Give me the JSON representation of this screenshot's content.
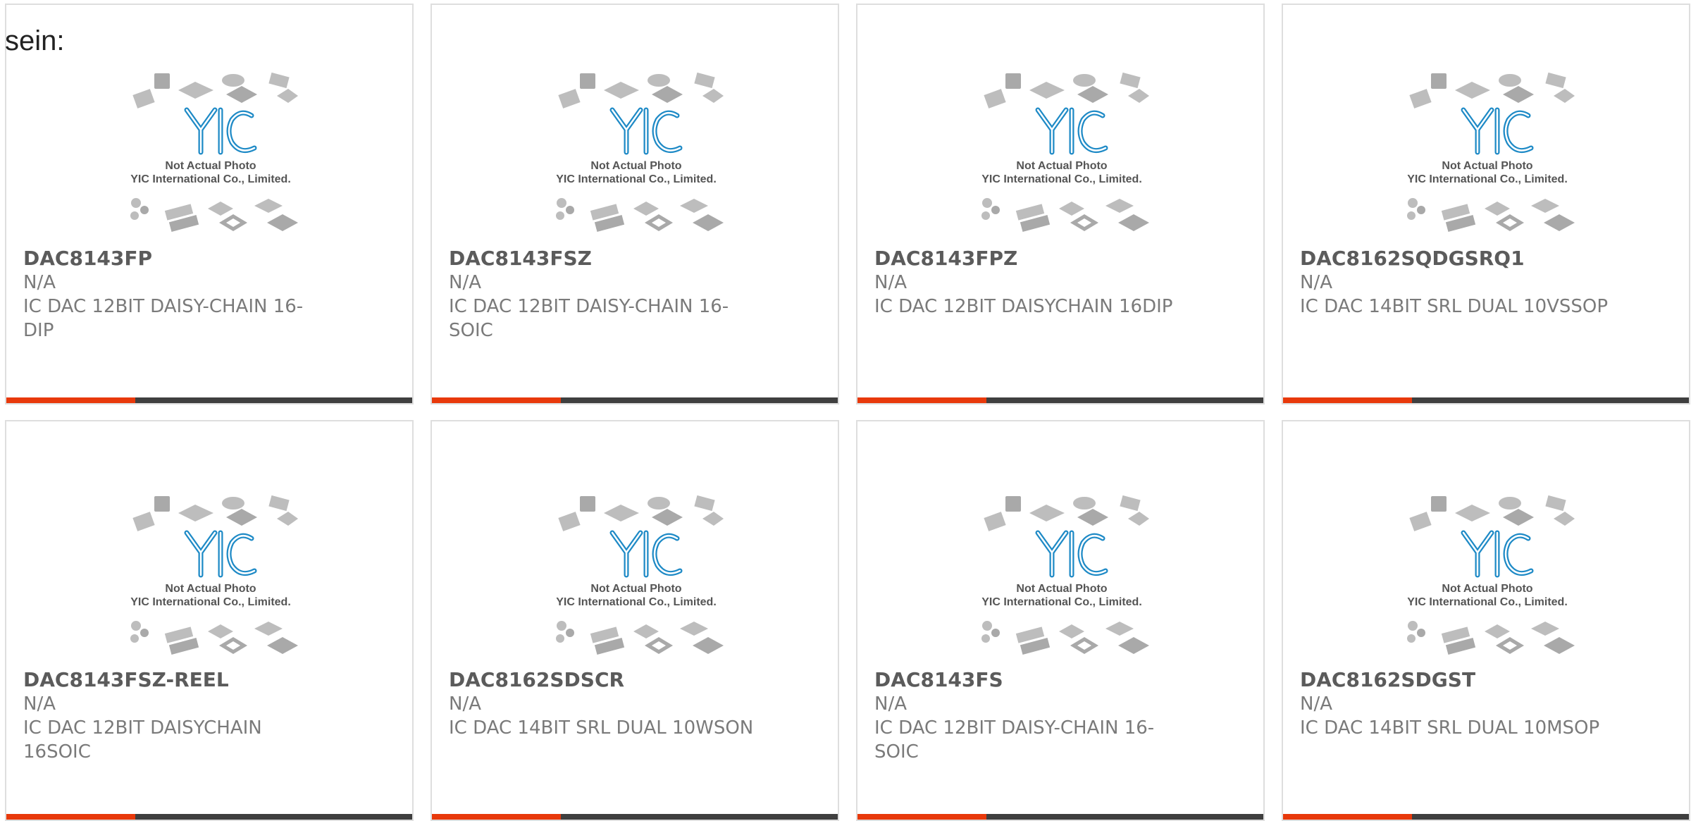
{
  "lead_text": "sein:",
  "placeholder": {
    "line1": "Not Actual Photo",
    "line2": "YIC International Co., Limited.",
    "logo": "YIC",
    "logo_color": "#1e8ac6"
  },
  "colors": {
    "accent": "#e8390b",
    "bar": "#3f3f3f",
    "border": "#dedede"
  },
  "products": [
    {
      "part": "DAC8143FP",
      "mfr": "N/A",
      "desc": "IC DAC 12BIT DAISY-CHAIN 16-DIP"
    },
    {
      "part": "DAC8143FSZ",
      "mfr": "N/A",
      "desc": "IC DAC 12BIT DAISY-CHAIN 16-SOIC"
    },
    {
      "part": "DAC8143FPZ",
      "mfr": "N/A",
      "desc": "IC DAC 12BIT DAISYCHAIN 16DIP"
    },
    {
      "part": "DAC8162SQDGSRQ1",
      "mfr": "N/A",
      "desc": "IC DAC 14BIT SRL DUAL 10VSSOP"
    },
    {
      "part": "DAC8143FSZ-REEL",
      "mfr": "N/A",
      "desc": "IC DAC 12BIT DAISYCHAIN 16SOIC"
    },
    {
      "part": "DAC8162SDSCR",
      "mfr": "N/A",
      "desc": "IC DAC 14BIT SRL DUAL 10WSON"
    },
    {
      "part": "DAC8143FS",
      "mfr": "N/A",
      "desc": "IC DAC 12BIT DAISY-CHAIN 16-SOIC"
    },
    {
      "part": "DAC8162SDGST",
      "mfr": "N/A",
      "desc": "IC DAC 14BIT SRL DUAL 10MSOP"
    }
  ]
}
